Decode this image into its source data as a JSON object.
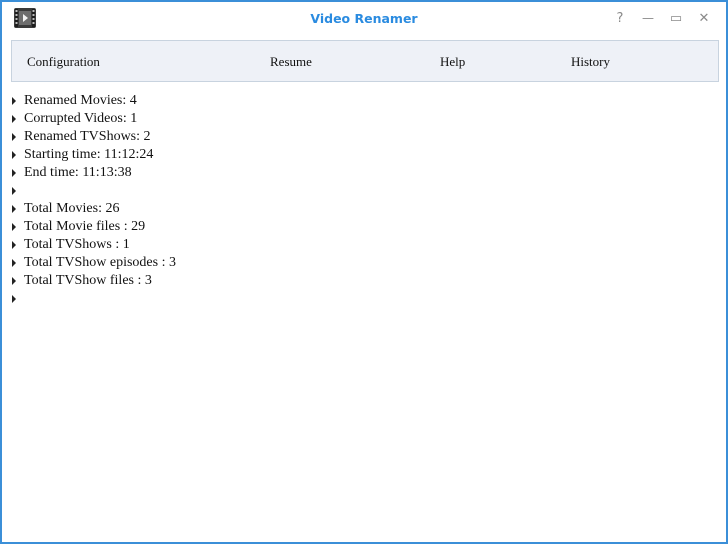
{
  "window": {
    "title": "Video Renamer",
    "icon": "film-clapper-icon",
    "controls": [
      {
        "name": "help",
        "glyph": "?"
      },
      {
        "name": "minimize",
        "glyph": "—"
      },
      {
        "name": "maximize",
        "glyph": "▭"
      },
      {
        "name": "close",
        "glyph": "✕"
      }
    ]
  },
  "menu": {
    "items": [
      "Configuration",
      "Resume",
      "Help",
      "History"
    ]
  },
  "log": {
    "lines": [
      "Renamed Movies: 4",
      "Corrupted Videos: 1",
      "Renamed TVShows: 2",
      "Starting time: 11:12:24",
      "End time: 11:13:38",
      "",
      "Total Movies: 26",
      "Total Movie files : 29",
      "Total TVShows : 1",
      "Total TVShow episodes : 3",
      "Total TVShow files : 3",
      ""
    ]
  },
  "colors": {
    "accent": "#2a8be0",
    "border": "#3b8fd8",
    "menu_bg": "#eef1f7"
  }
}
